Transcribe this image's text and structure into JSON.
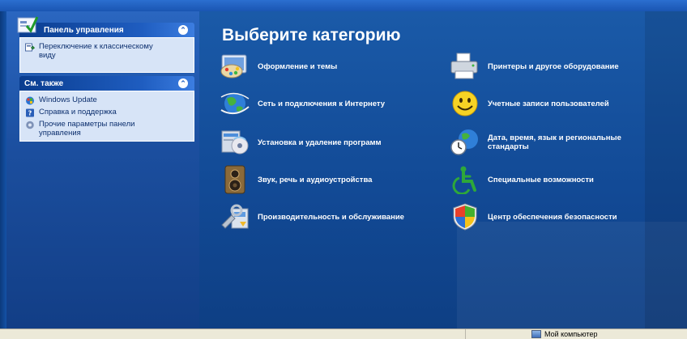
{
  "sidebar": {
    "control_panel": {
      "header": "Панель управления",
      "items": [
        {
          "label": "Переключение к классическому виду",
          "icon": "switch-view-icon"
        }
      ]
    },
    "see_also": {
      "header": "См. также",
      "items": [
        {
          "label": "Windows Update",
          "icon": "windows-update-icon"
        },
        {
          "label": "Справка и поддержка",
          "icon": "help-icon"
        },
        {
          "label": "Прочие параметры панели управления",
          "icon": "other-options-icon"
        }
      ]
    }
  },
  "main": {
    "title": "Выберите категорию",
    "categories": [
      {
        "label": "Оформление и темы",
        "icon": "appearance-themes-icon"
      },
      {
        "label": "Принтеры и другое оборудование",
        "icon": "printer-icon"
      },
      {
        "label": "Сеть и подключения к Интернету",
        "icon": "network-globe-icon"
      },
      {
        "label": "Учетные записи пользователей",
        "icon": "user-accounts-icon"
      },
      {
        "label": "Установка и удаление программ",
        "icon": "add-remove-programs-icon"
      },
      {
        "label": "Дата, время, язык и региональные стандарты",
        "icon": "date-time-globe-icon"
      },
      {
        "label": "Звук, речь и аудиоустройства",
        "icon": "speaker-icon"
      },
      {
        "label": "Специальные возможности",
        "icon": "accessibility-icon"
      },
      {
        "label": "Производительность и обслуживание",
        "icon": "performance-icon"
      },
      {
        "label": "Центр обеспечения безопасности",
        "icon": "security-shield-icon"
      }
    ]
  },
  "statusbar": {
    "location": "Мой компьютер"
  }
}
